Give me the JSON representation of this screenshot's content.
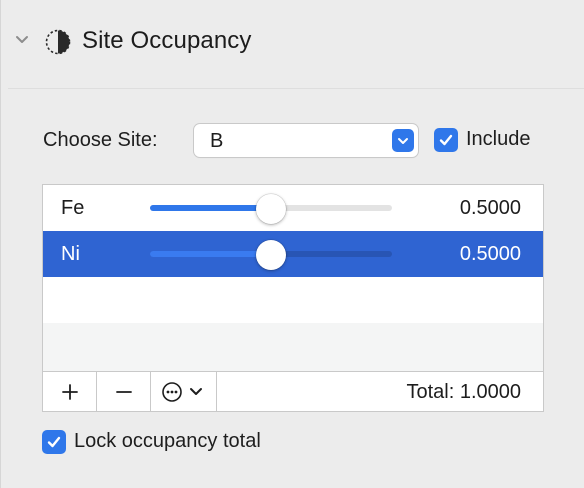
{
  "section": {
    "title": "Site Occupancy",
    "expanded": true
  },
  "site_chooser": {
    "label": "Choose Site:",
    "selected": "B",
    "include_label": "Include",
    "include_checked": true
  },
  "occupancies": [
    {
      "element": "Fe",
      "value_text": "0.5000",
      "value": 0.5,
      "selected": false
    },
    {
      "element": "Ni",
      "value_text": "0.5000",
      "value": 0.5,
      "selected": true
    }
  ],
  "toolbar": {
    "add_label": "+",
    "remove_label": "−",
    "total_text": "Total: 1.0000"
  },
  "lock": {
    "label": "Lock occupancy total",
    "checked": true
  },
  "colors": {
    "accent": "#2f77ea",
    "selection": "#2f64d2",
    "background": "#ececec"
  }
}
